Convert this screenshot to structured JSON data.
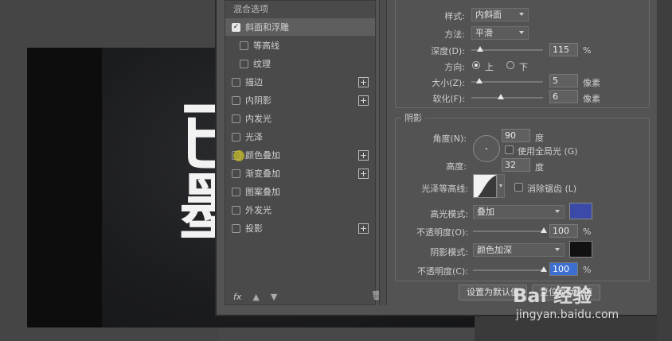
{
  "canvas": {
    "art_text": "已\n墨"
  },
  "styles_panel": {
    "header": "混合选项",
    "items": [
      {
        "label": "斜面和浮雕",
        "checked": true,
        "selected": true,
        "plus": false,
        "indent": false
      },
      {
        "label": "等高线",
        "checked": false,
        "selected": false,
        "plus": false,
        "indent": true
      },
      {
        "label": "纹理",
        "checked": false,
        "selected": false,
        "plus": false,
        "indent": true
      },
      {
        "label": "描边",
        "checked": false,
        "selected": false,
        "plus": true,
        "indent": false
      },
      {
        "label": "内阴影",
        "checked": false,
        "selected": false,
        "plus": true,
        "indent": false
      },
      {
        "label": "内发光",
        "checked": false,
        "selected": false,
        "plus": false,
        "indent": false
      },
      {
        "label": "光泽",
        "checked": false,
        "selected": false,
        "plus": false,
        "indent": false
      },
      {
        "label": "颜色叠加",
        "checked": false,
        "selected": false,
        "plus": true,
        "indent": false
      },
      {
        "label": "渐变叠加",
        "checked": false,
        "selected": false,
        "plus": true,
        "indent": false
      },
      {
        "label": "图案叠加",
        "checked": false,
        "selected": false,
        "plus": false,
        "indent": false
      },
      {
        "label": "外发光",
        "checked": false,
        "selected": false,
        "plus": false,
        "indent": false
      },
      {
        "label": "投影",
        "checked": false,
        "selected": false,
        "plus": true,
        "indent": false
      }
    ],
    "fx_label": "fx",
    "up_icon": "arrow-up-icon",
    "down_icon": "arrow-down-icon",
    "trash_icon": "trash-icon"
  },
  "structure": {
    "style_label": "样式:",
    "style_value": "内斜面",
    "technique_label": "方法:",
    "technique_value": "平滑",
    "depth_label": "深度(D):",
    "depth_value": "115",
    "depth_unit": "%",
    "direction_label": "方向:",
    "direction_up": "上",
    "direction_down": "下",
    "size_label": "大小(Z):",
    "size_value": "5",
    "size_unit": "像素",
    "soften_label": "软化(F):",
    "soften_value": "6",
    "soften_unit": "像素"
  },
  "shading": {
    "title": "阴影",
    "angle_label": "角度(N):",
    "angle_value": "90",
    "angle_unit": "度",
    "global_light_label": "使用全局光 (G)",
    "altitude_label": "高度:",
    "altitude_value": "32",
    "altitude_unit": "度",
    "gloss_label": "光泽等高线:",
    "antialias_label": "消除锯齿 (L)",
    "highlight_mode_label": "高光模式:",
    "highlight_mode_value": "叠加",
    "highlight_color": "#3a4aa6",
    "highlight_opacity_label": "不透明度(O):",
    "highlight_opacity_value": "100",
    "highlight_opacity_unit": "%",
    "shadow_mode_label": "阴影模式:",
    "shadow_mode_value": "颜色加深",
    "shadow_color": "#111111",
    "shadow_opacity_label": "不透明度(C):",
    "shadow_opacity_value": "100",
    "shadow_opacity_unit": "%"
  },
  "buttons": {
    "make_default": "设置为默认值",
    "reset_default": "复位为默认值"
  },
  "watermark": {
    "brand": "Bai 经验",
    "url": "jingyan.baidu.com"
  }
}
